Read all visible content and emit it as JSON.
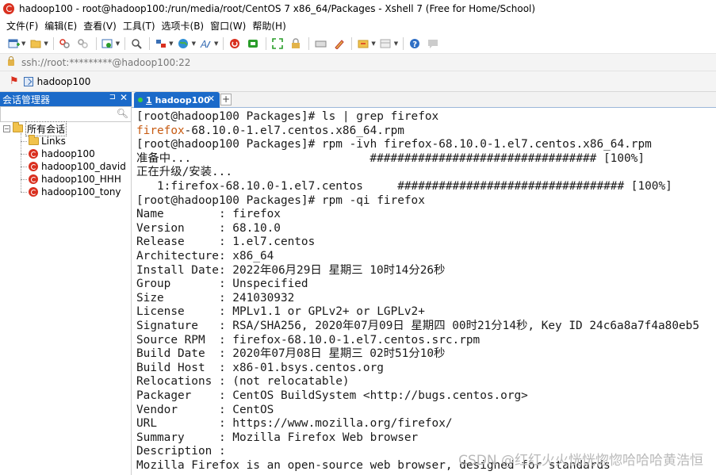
{
  "window": {
    "title": "hadoop100 - root@hadoop100:/run/media/root/CentOS 7 x86_64/Packages - Xshell 7 (Free for Home/School)"
  },
  "menu": [
    "文件(F)",
    "编辑(E)",
    "查看(V)",
    "工具(T)",
    "选项卡(B)",
    "窗口(W)",
    "帮助(H)"
  ],
  "address": {
    "text": "ssh://root:*********@hadoop100:22"
  },
  "quick_session": {
    "label": "hadoop100"
  },
  "sidebar": {
    "title": "会话管理器",
    "pin_glyph": "⊐",
    "close_glyph": "✕",
    "root_label": "所有会话",
    "items": [
      {
        "label": "Links",
        "type": "folder"
      },
      {
        "label": "hadoop100",
        "type": "session"
      },
      {
        "label": "hadoop100_david",
        "type": "session"
      },
      {
        "label": "hadoop100_HHH",
        "type": "session"
      },
      {
        "label": "hadoop100_tony",
        "type": "session"
      }
    ]
  },
  "tabs": [
    {
      "number": "1",
      "label": "hadoop100",
      "close": "✕"
    }
  ],
  "tab_add": "+",
  "terminal": {
    "lines": [
      "[root@hadoop100 Packages]# ls | grep firefox",
      {
        "highlight": "firefox",
        "rest": "-68.10.0-1.el7.centos.x86_64.rpm"
      },
      "[root@hadoop100 Packages]# rpm -ivh firefox-68.10.0-1.el7.centos.x86_64.rpm",
      "准备中...                          ################################# [100%]",
      "正在升级/安装...",
      "   1:firefox-68.10.0-1.el7.centos     ################################# [100%]",
      "[root@hadoop100 Packages]# rpm -qi firefox",
      "Name        : firefox",
      "Version     : 68.10.0",
      "Release     : 1.el7.centos",
      "Architecture: x86_64",
      "Install Date: 2022年06月29日 星期三 10时14分26秒",
      "Group       : Unspecified",
      "Size        : 241030932",
      "License     : MPLv1.1 or GPLv2+ or LGPLv2+",
      "Signature   : RSA/SHA256, 2020年07月09日 星期四 00时21分14秒, Key ID 24c6a8a7f4a80eb5",
      "Source RPM  : firefox-68.10.0-1.el7.centos.src.rpm",
      "Build Date  : 2020年07月08日 星期三 02时51分10秒",
      "Build Host  : x86-01.bsys.centos.org",
      "Relocations : (not relocatable)",
      "Packager    : CentOS BuildSystem <http://bugs.centos.org>",
      "Vendor      : CentOS",
      "URL         : https://www.mozilla.org/firefox/",
      "Summary     : Mozilla Firefox Web browser",
      "Description :",
      "Mozilla Firefox is an open-source web browser, designed for standards"
    ]
  },
  "watermark": "CSDN @红红火火恍恍惚惚哈哈哈黄浩恒",
  "colors": {
    "accent": "#1b6ac9",
    "highlight": "#c75b12",
    "session_icon": "#d9301f"
  },
  "toolbar_icons": [
    "new-session-icon",
    "open-folder-icon",
    "reconnect-icon",
    "disconnect-icon",
    "properties-icon",
    "find-icon",
    "transfer-icon",
    "globe-icon",
    "font-icon",
    "xshell-icon",
    "xftp-icon",
    "fullscreen-icon",
    "lock-icon",
    "keyboard-icon",
    "highlight-icon",
    "compose-icon",
    "layout-icon",
    "help-icon",
    "chat-icon"
  ]
}
